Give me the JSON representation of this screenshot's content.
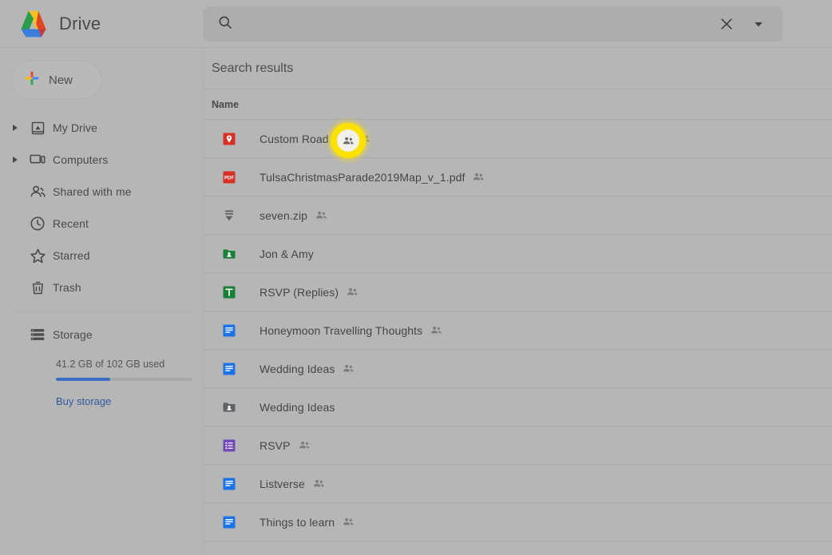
{
  "app": {
    "brand_title": "Drive",
    "logo_icon": "google-drive-logo"
  },
  "search": {
    "placeholder": "",
    "value": "",
    "search_icon": "search-icon",
    "clear_icon": "close-icon",
    "dropdown_icon": "chevron-down-icon"
  },
  "sidebar": {
    "new_button": {
      "label": "New",
      "icon": "plus-icon"
    },
    "items": [
      {
        "label": "My Drive",
        "icon": "my-drive-icon",
        "expandable": true
      },
      {
        "label": "Computers",
        "icon": "computer-icon",
        "expandable": true
      },
      {
        "label": "Shared with me",
        "icon": "people-icon",
        "expandable": false
      },
      {
        "label": "Recent",
        "icon": "clock-icon",
        "expandable": false
      },
      {
        "label": "Starred",
        "icon": "star-icon",
        "expandable": false
      },
      {
        "label": "Trash",
        "icon": "trash-icon",
        "expandable": false
      }
    ],
    "storage": {
      "label": "Storage",
      "icon": "storage-icon",
      "usage_text": "41.2 GB of 102 GB used",
      "used_percent": 40,
      "buy_link": "Buy storage",
      "bar_color": "#3b6fc4",
      "link_color": "#30579e"
    }
  },
  "main": {
    "results_title": "Search results",
    "column_header": "Name",
    "files": [
      {
        "name": "Custom Road Trip",
        "icon": "map-pin-icon",
        "icon_color": "#d93025",
        "shared": true
      },
      {
        "name": "TulsaChristmasParade2019Map_v_1.pdf",
        "icon": "pdf-icon",
        "icon_color": "#d93025",
        "shared": true
      },
      {
        "name": "seven.zip",
        "icon": "archive-icon",
        "icon_color": "#5f6368",
        "shared": true
      },
      {
        "name": "Jon & Amy",
        "icon": "shared-folder-icon",
        "icon_color": "#188038",
        "shared": false
      },
      {
        "name": "RSVP (Replies)",
        "icon": "sheets-icon",
        "icon_color": "#188038",
        "shared": true
      },
      {
        "name": "Honeymoon Travelling Thoughts",
        "icon": "docs-icon",
        "icon_color": "#1a73e8",
        "shared": true
      },
      {
        "name": "Wedding Ideas",
        "icon": "docs-icon",
        "icon_color": "#1a73e8",
        "shared": true
      },
      {
        "name": "Wedding Ideas",
        "icon": "shared-folder-icon",
        "icon_color": "#5f6368",
        "shared": false
      },
      {
        "name": "RSVP",
        "icon": "forms-icon",
        "icon_color": "#7248b9",
        "shared": true
      },
      {
        "name": "Listverse",
        "icon": "docs-icon",
        "icon_color": "#1a73e8",
        "shared": true
      },
      {
        "name": "Things to learn",
        "icon": "docs-icon",
        "icon_color": "#1a73e8",
        "shared": true
      }
    ]
  },
  "highlight": {
    "target": "shared-icon-custom-road-trip",
    "ring_color": "#ffe100"
  }
}
